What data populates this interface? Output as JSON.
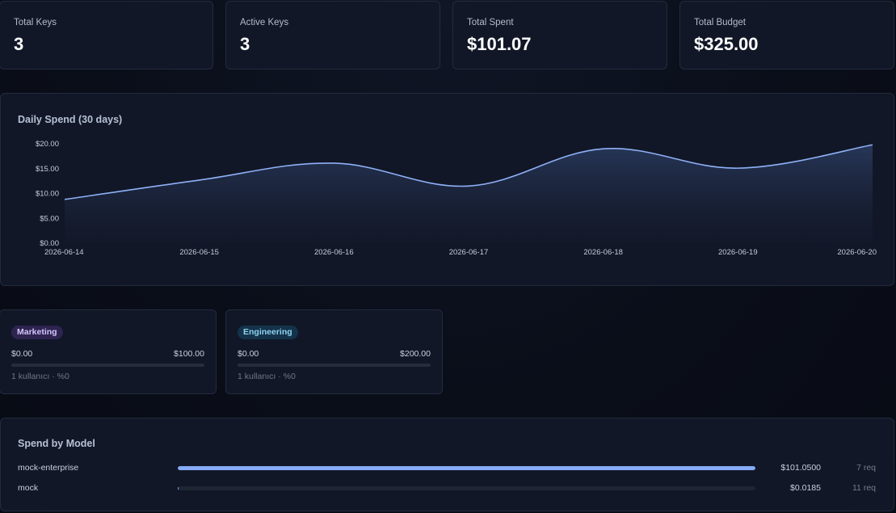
{
  "stats": [
    {
      "label": "Total Keys",
      "value": "3"
    },
    {
      "label": "Active Keys",
      "value": "3"
    },
    {
      "label": "Total Spent",
      "value": "$101.07"
    },
    {
      "label": "Total Budget",
      "value": "$325.00"
    }
  ],
  "chart": {
    "title": "Daily Spend (30 days)"
  },
  "chart_data": {
    "type": "area",
    "title": "Daily Spend (30 days)",
    "xlabel": "",
    "ylabel": "",
    "x": [
      "2026-06-14",
      "2026-06-15",
      "2026-06-16",
      "2026-06-17",
      "2026-06-18",
      "2026-06-19",
      "2026-06-20"
    ],
    "y_ticks": [
      "$0.00",
      "$5.00",
      "$10.00",
      "$15.00",
      "$20.00"
    ],
    "ylim": [
      0,
      20
    ],
    "series": [
      {
        "values": [
          8.8,
          12.7,
          16.1,
          11.5,
          19.0,
          15.1,
          19.8
        ]
      }
    ],
    "line_color": "#8fb0f7",
    "grid": false,
    "legend": "none"
  },
  "groups": [
    {
      "name": "Marketing",
      "spent": "$0.00",
      "budget": "$100.00",
      "meta": "1 kullanıcı · %0",
      "percent": 0
    },
    {
      "name": "Engineering",
      "spent": "$0.00",
      "budget": "$200.00",
      "meta": "1 kullanıcı · %0",
      "percent": 0
    }
  ],
  "models": {
    "title": "Spend by Model",
    "rows": [
      {
        "name": "mock-enterprise",
        "cost": "$101.0500",
        "requests": "7 req",
        "share": 1.0
      },
      {
        "name": "mock",
        "cost": "$0.0185",
        "requests": "11 req",
        "share": 0.0002
      }
    ]
  },
  "colors": {
    "accent": "#86aaf6",
    "marketing_pill": "#2e2450",
    "engineering_pill": "#14334a"
  }
}
